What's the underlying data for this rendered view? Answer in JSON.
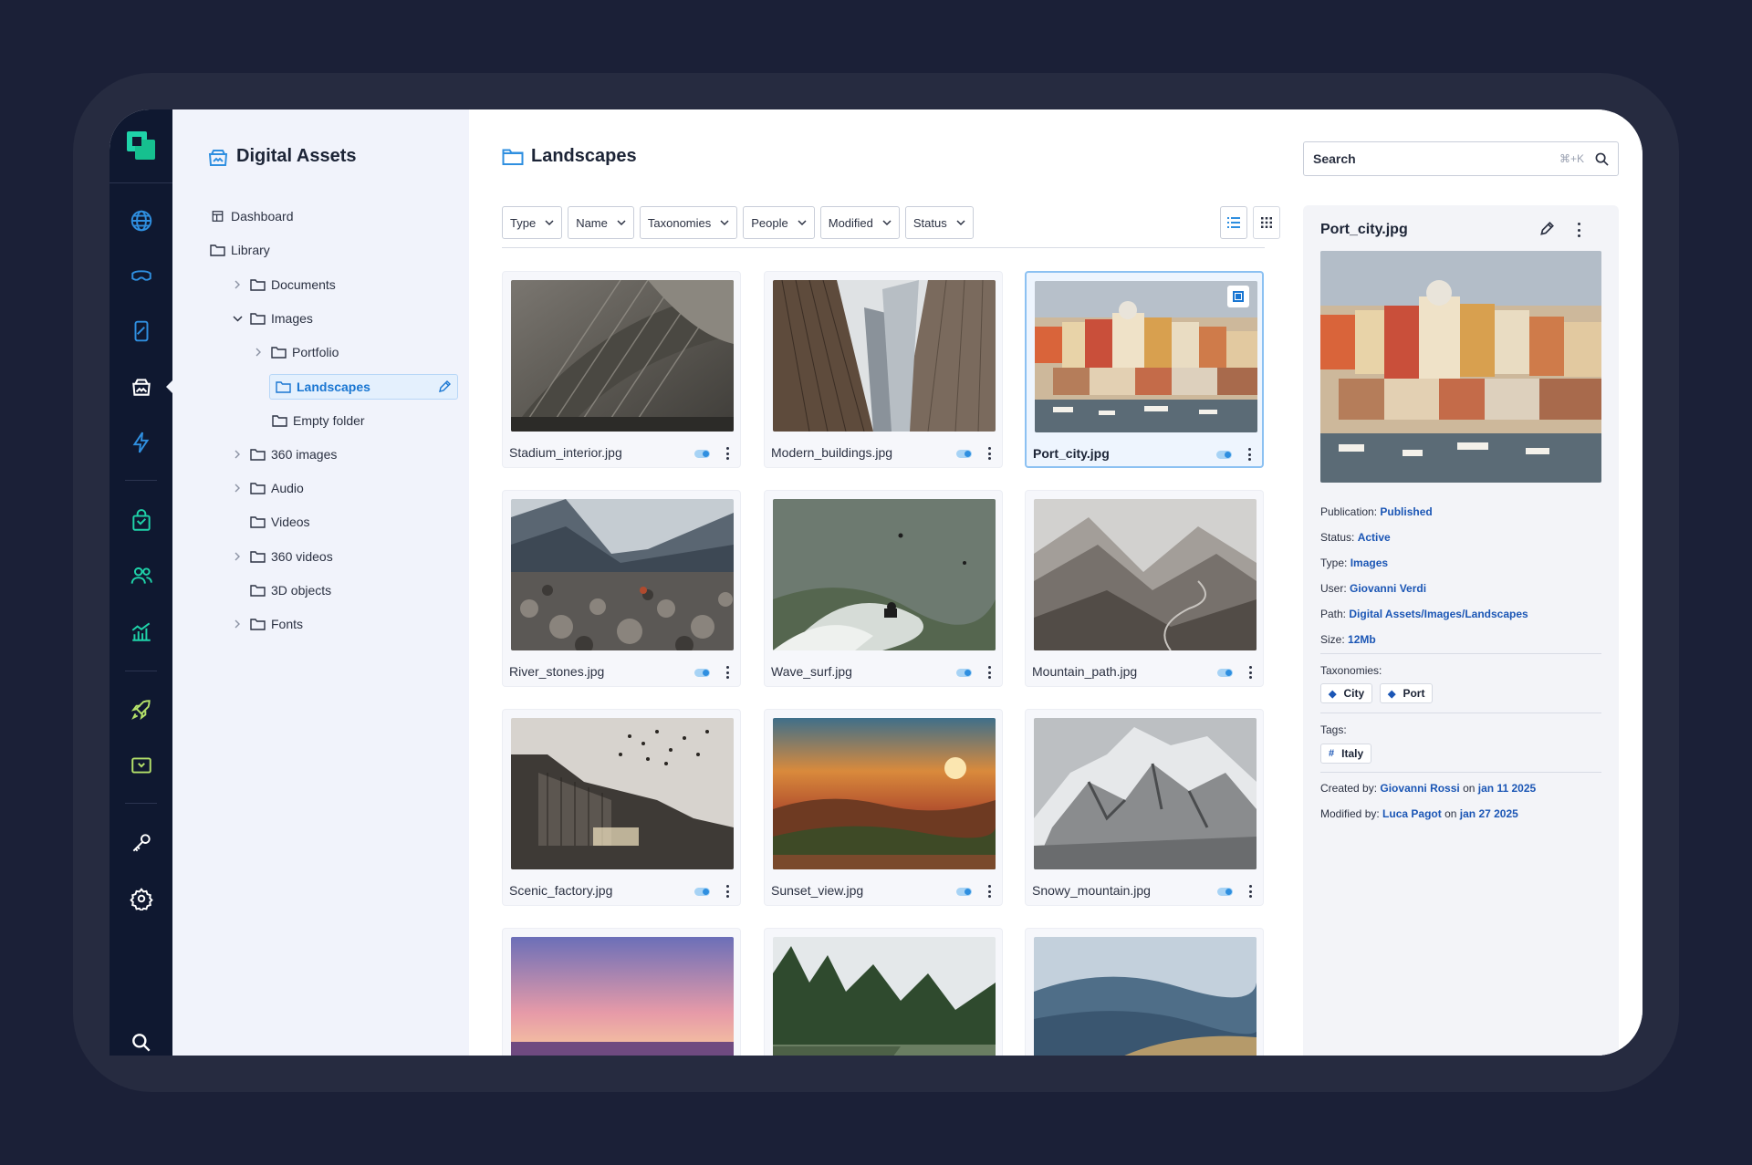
{
  "sidebar": {
    "title": "Digital Assets",
    "items": [
      {
        "label": "Dashboard"
      },
      {
        "label": "Library"
      },
      {
        "label": "Documents"
      },
      {
        "label": "Images"
      },
      {
        "label": "Portfolio"
      },
      {
        "label": "Landscapes"
      },
      {
        "label": "Empty folder"
      },
      {
        "label": "360 images"
      },
      {
        "label": "Audio"
      },
      {
        "label": "Videos"
      },
      {
        "label": "360 videos"
      },
      {
        "label": "3D objects"
      },
      {
        "label": "Fonts"
      }
    ]
  },
  "main": {
    "title": "Landscapes",
    "filters": [
      "Type",
      "Name",
      "Taxonomies",
      "People",
      "Modified",
      "Status"
    ],
    "assets": [
      {
        "name": "Stadium_interior.jpg"
      },
      {
        "name": "Modern_buildings.jpg"
      },
      {
        "name": "Port_city.jpg",
        "selected": true
      },
      {
        "name": "River_stones.jpg"
      },
      {
        "name": "Wave_surf.jpg"
      },
      {
        "name": "Mountain_path.jpg"
      },
      {
        "name": "Scenic_factory.jpg"
      },
      {
        "name": "Sunset_view.jpg"
      },
      {
        "name": "Snowy_mountain.jpg"
      },
      {
        "name": ""
      },
      {
        "name": ""
      },
      {
        "name": ""
      }
    ]
  },
  "search": {
    "label": "Search",
    "shortcut": "⌘+K"
  },
  "details": {
    "title": "Port_city.jpg",
    "publication_label": "Publication:",
    "publication": "Published",
    "status_label": "Status:",
    "status": "Active",
    "type_label": "Type:",
    "type": "Images",
    "user_label": "User:",
    "user": "Giovanni Verdi",
    "path_label": "Path:",
    "path": "Digital Assets/Images/Landscapes",
    "size_label": "Size:",
    "size": "12Mb",
    "taxonomies_label": "Taxonomies:",
    "taxonomies": [
      "City",
      "Port"
    ],
    "tags_label": "Tags:",
    "tags": [
      "Italy"
    ],
    "created_label": "Created by:",
    "created_by": "Giovanni Rossi",
    "created_on_word": "on",
    "created_date": "jan 11 2025",
    "modified_label": "Modified by:",
    "modified_by": "Luca Pagot",
    "modified_on_word": "on",
    "modified_date": "jan 27 2025"
  },
  "colors": {
    "accent": "#1976d2",
    "link": "#1b56b5",
    "rail": "#0f1830",
    "rail_icon": "#1fd3a9",
    "rail_icon_blue": "#2f8fe0"
  },
  "icons": [
    "logo-icon",
    "globe-icon",
    "vr-headset-icon",
    "phone-icon",
    "digital-assets-icon",
    "bolt-icon",
    "shopping-bag-icon",
    "users-icon",
    "analytics-icon",
    "rocket-icon",
    "media-icon",
    "key-icon",
    "gear-icon",
    "search-icon"
  ]
}
